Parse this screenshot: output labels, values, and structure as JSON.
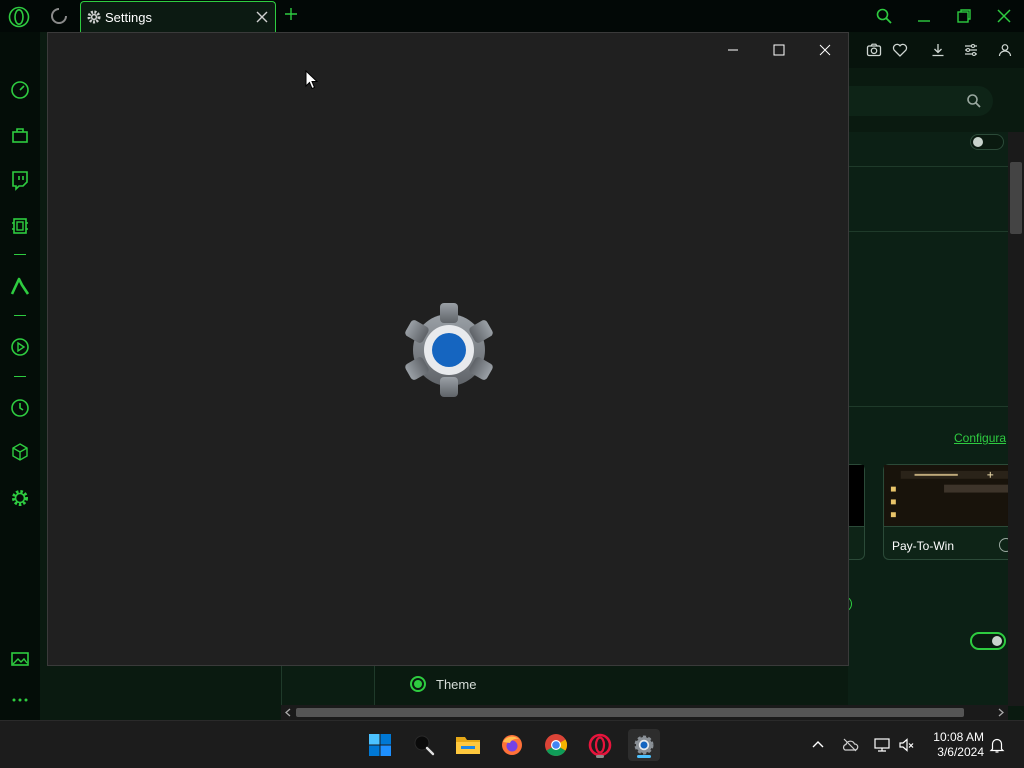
{
  "browser": {
    "tab": {
      "title": "Settings"
    },
    "colors": {
      "accent": "#2ecc40",
      "background": "#05120a"
    },
    "sidebar_icons": [
      "speed-dial-icon",
      "shopping-bag-icon",
      "twitch-icon",
      "hardware-chip-icon",
      "aria-icon",
      "player-icon",
      "history-icon",
      "extensions-cube-icon",
      "settings-gear-icon",
      "image-gallery-icon",
      "more-icon"
    ],
    "toolbar_icons": [
      "camera-icon",
      "heart-icon",
      "download-icon",
      "easy-setup-icon",
      "profile-icon"
    ]
  },
  "background_page": {
    "configure_link": "Configura",
    "theme_card_label": "Pay-To-Win",
    "theme_row_label": "Theme"
  },
  "settings_window": {
    "controls": [
      "minimize",
      "maximize",
      "close"
    ],
    "splash_icon": "settings-gear-icon"
  },
  "taskbar": {
    "apps": [
      "start-icon",
      "search-icon",
      "file-explorer-icon",
      "firefox-icon",
      "chrome-icon",
      "opera-gx-icon",
      "settings-icon"
    ],
    "clock": {
      "time": "10:08 AM",
      "date": "3/6/2024"
    }
  }
}
